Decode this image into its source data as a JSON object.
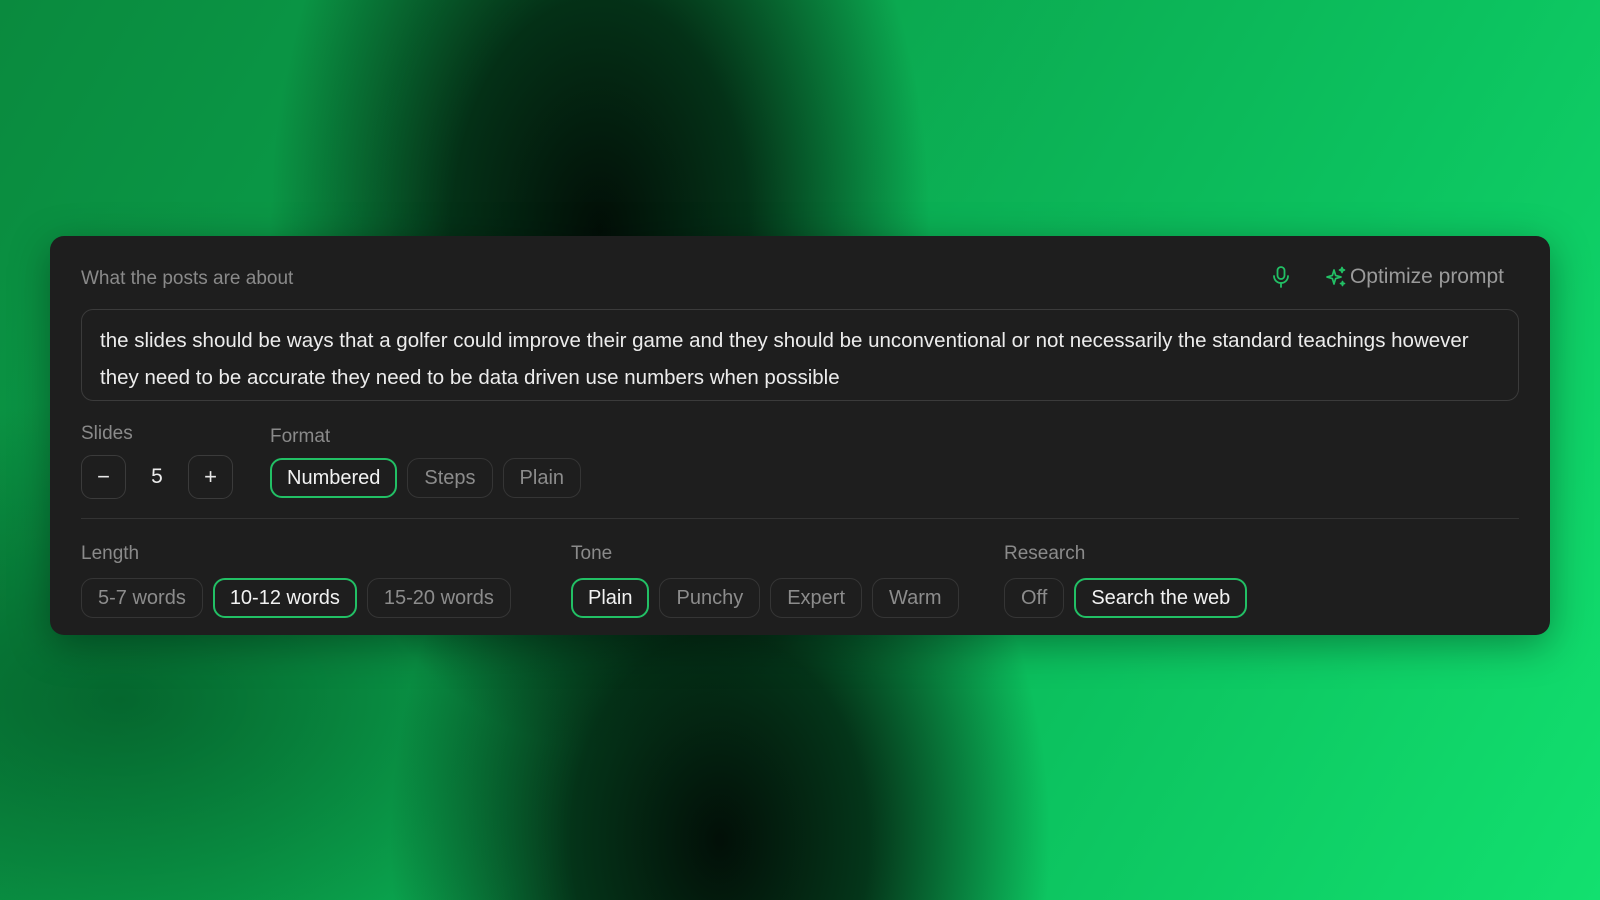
{
  "header": {
    "label": "What the posts are about",
    "optimize_label": "Optimize prompt"
  },
  "prompt": {
    "value": "the slides should be ways that a golfer could improve their game and they should be unconventional or not necessarily the standard teachings however they need to be accurate they need to be data driven use numbers when possible"
  },
  "slides": {
    "label": "Slides",
    "value": "5",
    "decrement": "−",
    "increment": "+"
  },
  "format": {
    "label": "Format",
    "options": [
      "Numbered",
      "Steps",
      "Plain"
    ],
    "selected": "Numbered"
  },
  "length": {
    "label": "Length",
    "options": [
      "5-7 words",
      "10-12 words",
      "15-20 words"
    ],
    "selected": "10-12 words"
  },
  "tone": {
    "label": "Tone",
    "options": [
      "Plain",
      "Punchy",
      "Expert",
      "Warm"
    ],
    "selected": "Plain"
  },
  "research": {
    "label": "Research",
    "options": [
      "Off",
      "Search the web"
    ],
    "selected": "Search the web"
  },
  "colors": {
    "accent": "#22c065",
    "panel": "#1e1e1e"
  },
  "icons": {
    "mic": "microphone-icon",
    "optimize": "sparkles-icon"
  }
}
